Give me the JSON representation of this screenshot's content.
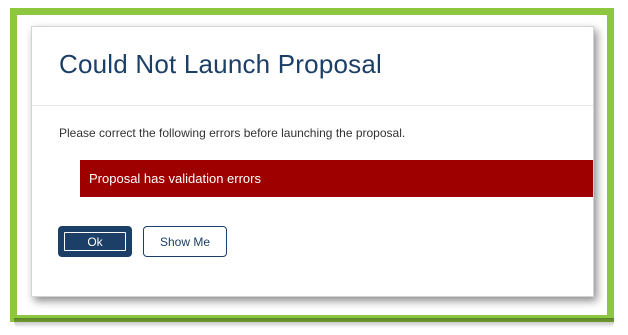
{
  "dialog": {
    "title": "Could Not Launch Proposal",
    "instruction": "Please correct the following errors before launching the proposal.",
    "error_message": "Proposal has validation errors"
  },
  "buttons": {
    "ok_label": "Ok",
    "show_me_label": "Show Me"
  },
  "colors": {
    "highlight_frame": "#8dc63f",
    "title_text": "#1b3f66",
    "error_banner": "#9e0000",
    "primary_button": "#1b3f66"
  }
}
